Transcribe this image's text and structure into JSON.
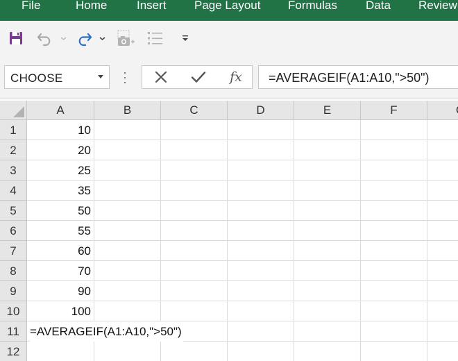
{
  "ribbon": {
    "tabs": [
      {
        "label": "File"
      },
      {
        "label": "Home"
      },
      {
        "label": "Insert"
      },
      {
        "label": "Page Layout"
      },
      {
        "label": "Formulas"
      },
      {
        "label": "Data"
      },
      {
        "label": "Review"
      }
    ],
    "background": "#217346"
  },
  "quick_access": {
    "icons": [
      "save-icon",
      "undo-icon",
      "redo-icon",
      "camera-icon",
      "list-icon",
      "customize-icon"
    ]
  },
  "formula_bar": {
    "name_box": "CHOOSE",
    "cancel_icon": "cancel-icon",
    "enter_icon": "checkmark-icon",
    "fx_label": "fx",
    "formula": "=AVERAGEIF(A1:A10,\">50\")"
  },
  "sheet": {
    "columns": [
      "A",
      "B",
      "C",
      "D",
      "E",
      "F",
      "G"
    ],
    "rows": [
      {
        "num": "1",
        "a": "10"
      },
      {
        "num": "2",
        "a": "20"
      },
      {
        "num": "3",
        "a": "25"
      },
      {
        "num": "4",
        "a": "35"
      },
      {
        "num": "5",
        "a": "50"
      },
      {
        "num": "6",
        "a": "55"
      },
      {
        "num": "7",
        "a": "60"
      },
      {
        "num": "8",
        "a": "70"
      },
      {
        "num": "9",
        "a": "90"
      },
      {
        "num": "10",
        "a": "100"
      },
      {
        "num": "11",
        "a": "=AVERAGEIF(A1:A10,\">50\")"
      },
      {
        "num": "12",
        "a": ""
      }
    ]
  }
}
